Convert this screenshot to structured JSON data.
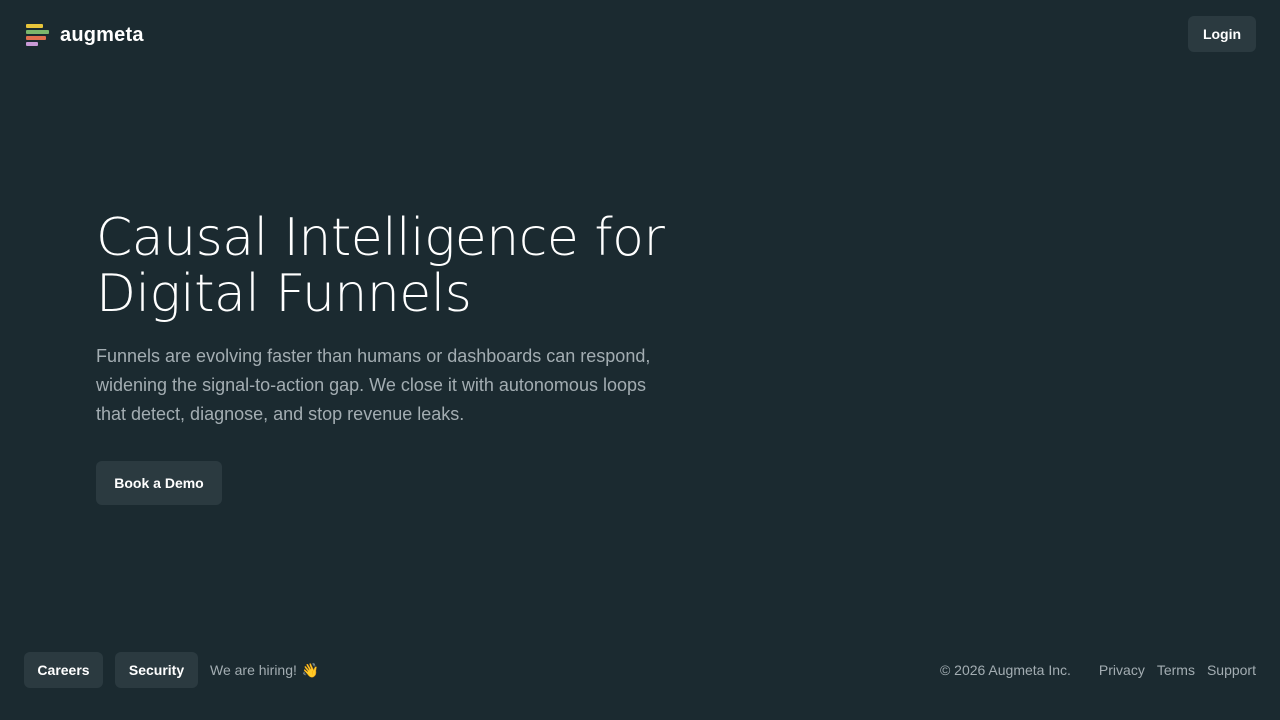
{
  "header": {
    "brand_name": "augmeta",
    "login_label": "Login"
  },
  "hero": {
    "title_line1": "Causal Intelligence for",
    "title_line2": "Digital Funnels",
    "subtitle": "Funnels are evolving faster than humans or dashboards can respond, widening the signal-to-action gap. We close it with autonomous loops that detect, diagnose, and stop revenue leaks.",
    "cta_label": "Book a Demo"
  },
  "footer": {
    "careers_label": "Careers",
    "security_label": "Security",
    "hiring_text": "We are hiring!",
    "hiring_icon": "waving-hand-icon",
    "copyright": "© 2026 Augmeta Inc.",
    "links": {
      "privacy": "Privacy",
      "terms": "Terms",
      "support": "Support"
    }
  },
  "colors": {
    "background": "#1b2a30",
    "button_bg": "#2b3a40",
    "muted_text": "#a3adb2",
    "logo_bars": [
      "#e8c53a",
      "#7bb66c",
      "#e06f4f",
      "#c99ad6"
    ]
  }
}
